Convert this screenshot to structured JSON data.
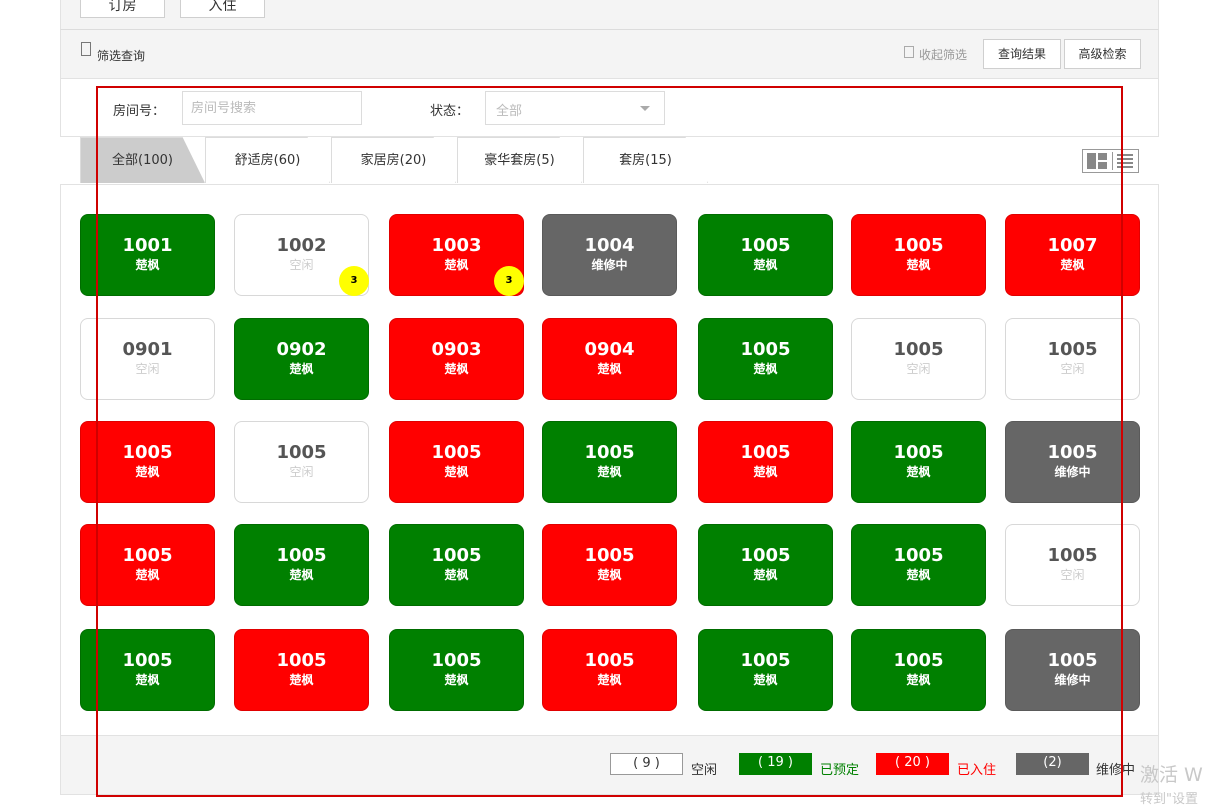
{
  "actions": {
    "book_label": "订房",
    "checkin_label": "入住"
  },
  "filter": {
    "title": "筛选查询",
    "collapse_label": "收起筛选",
    "results_label": "查询结果",
    "advanced_label": "高级检索"
  },
  "search": {
    "room_label": "房间号：",
    "room_placeholder": "房间号搜索",
    "status_label": "状态：",
    "status_value": "全部"
  },
  "tabs": [
    {
      "label": "全部(100)",
      "active": true
    },
    {
      "label": "舒适房(60)"
    },
    {
      "label": "家居房(20)"
    },
    {
      "label": "豪华套房(5)"
    },
    {
      "label": "套房(15)"
    }
  ],
  "rooms": [
    {
      "num": "1001",
      "guest": "楚枫",
      "status": "reserved"
    },
    {
      "num": "1002",
      "guest": "空闲",
      "status": "vacant",
      "badge": "3"
    },
    {
      "num": "1003",
      "guest": "楚枫",
      "status": "occupied",
      "badge": "3"
    },
    {
      "num": "1004",
      "guest": "维修中",
      "status": "maintenance"
    },
    {
      "num": "1005",
      "guest": "楚枫",
      "status": "reserved"
    },
    {
      "num": "1005",
      "guest": "楚枫",
      "status": "occupied"
    },
    {
      "num": "1007",
      "guest": "楚枫",
      "status": "occupied"
    },
    {
      "num": "0901",
      "guest": "空闲",
      "status": "vacant"
    },
    {
      "num": "0902",
      "guest": "楚枫",
      "status": "reserved"
    },
    {
      "num": "0903",
      "guest": "楚枫",
      "status": "occupied"
    },
    {
      "num": "0904",
      "guest": "楚枫",
      "status": "occupied"
    },
    {
      "num": "1005",
      "guest": "楚枫",
      "status": "reserved"
    },
    {
      "num": "1005",
      "guest": "空闲",
      "status": "vacant"
    },
    {
      "num": "1005",
      "guest": "空闲",
      "status": "vacant"
    },
    {
      "num": "1005",
      "guest": "楚枫",
      "status": "occupied"
    },
    {
      "num": "1005",
      "guest": "空闲",
      "status": "vacant"
    },
    {
      "num": "1005",
      "guest": "楚枫",
      "status": "occupied"
    },
    {
      "num": "1005",
      "guest": "楚枫",
      "status": "reserved"
    },
    {
      "num": "1005",
      "guest": "楚枫",
      "status": "occupied"
    },
    {
      "num": "1005",
      "guest": "楚枫",
      "status": "reserved"
    },
    {
      "num": "1005",
      "guest": "维修中",
      "status": "maintenance"
    },
    {
      "num": "1005",
      "guest": "楚枫",
      "status": "occupied"
    },
    {
      "num": "1005",
      "guest": "楚枫",
      "status": "reserved"
    },
    {
      "num": "1005",
      "guest": "楚枫",
      "status": "reserved"
    },
    {
      "num": "1005",
      "guest": "楚枫",
      "status": "occupied"
    },
    {
      "num": "1005",
      "guest": "楚枫",
      "status": "reserved"
    },
    {
      "num": "1005",
      "guest": "楚枫",
      "status": "reserved"
    },
    {
      "num": "1005",
      "guest": "空闲",
      "status": "vacant"
    },
    {
      "num": "1005",
      "guest": "楚枫",
      "status": "reserved"
    },
    {
      "num": "1005",
      "guest": "楚枫",
      "status": "occupied"
    },
    {
      "num": "1005",
      "guest": "楚枫",
      "status": "reserved"
    },
    {
      "num": "1005",
      "guest": "楚枫",
      "status": "occupied"
    },
    {
      "num": "1005",
      "guest": "楚枫",
      "status": "reserved"
    },
    {
      "num": "1005",
      "guest": "楚枫",
      "status": "reserved"
    },
    {
      "num": "1005",
      "guest": "维修中",
      "status": "maintenance"
    }
  ],
  "legend": {
    "vacant": {
      "count": "( 9 )",
      "label": "空闲"
    },
    "reserved": {
      "count": "( 19 )",
      "label": "已预定"
    },
    "occupied": {
      "count": "( 20 )",
      "label": "已入住"
    },
    "maintenance": {
      "count": "(2)",
      "label": "维修中"
    }
  },
  "colors": {
    "occupied": "#ff0000",
    "reserved": "#008000",
    "maintenance": "#666666",
    "vacant": "#ffffff",
    "badge": "#ffff00",
    "selection_frame": "#d00000"
  },
  "icons": {
    "filter": "filter-icon",
    "collapse": "collapse-icon",
    "grid_view": "grid-view-icon",
    "list_view": "list-view-icon",
    "dropdown": "chevron-down-icon"
  },
  "watermark": {
    "line1": "激活 W",
    "line2": "转到\"设置"
  }
}
